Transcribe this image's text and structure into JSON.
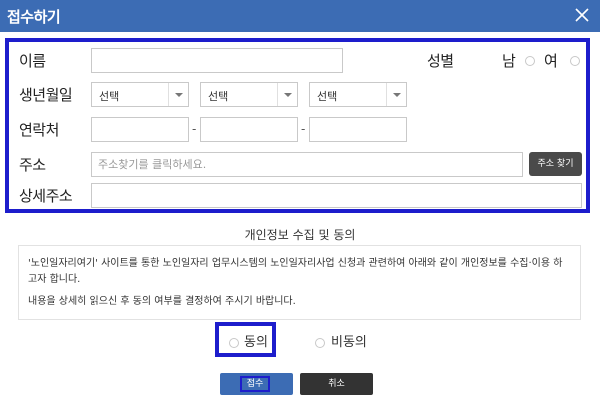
{
  "title": "접수하기",
  "form": {
    "name_label": "이름",
    "name_value": "",
    "gender_label": "성별",
    "gender_male": "남",
    "gender_female": "여",
    "birth_label": "생년월일",
    "birth_year": "선택",
    "birth_month": "선택",
    "birth_day": "선택",
    "phone_label": "연락처",
    "phone_sep": "-",
    "phone_1": "",
    "phone_2": "",
    "phone_3": "",
    "address_label": "주소",
    "address_placeholder": "주소찾기를 클릭하세요.",
    "address_search_button": "주소 찾기",
    "detail_address_label": "상세주소",
    "detail_address_value": ""
  },
  "privacy": {
    "section_title": "개인정보 수집 및 동의",
    "notice_line1": "'노인일자리여기' 사이트를 통한 노인일자리 업무시스템의 노인일자리사업 신청과 관련하여 아래와 같이 개인정보를 수집·이용 하고자 합니다.",
    "notice_line2": "내용을 상세히 읽으신 후 동의 여부를 결정하여 주시기 바랍니다.",
    "agree_label": "동의",
    "disagree_label": "비동의"
  },
  "actions": {
    "submit_label": "접수",
    "cancel_label": "취소"
  },
  "colors": {
    "header": "#3c6cb4",
    "highlight": "#1d1dcc",
    "dark_button": "#333333"
  }
}
